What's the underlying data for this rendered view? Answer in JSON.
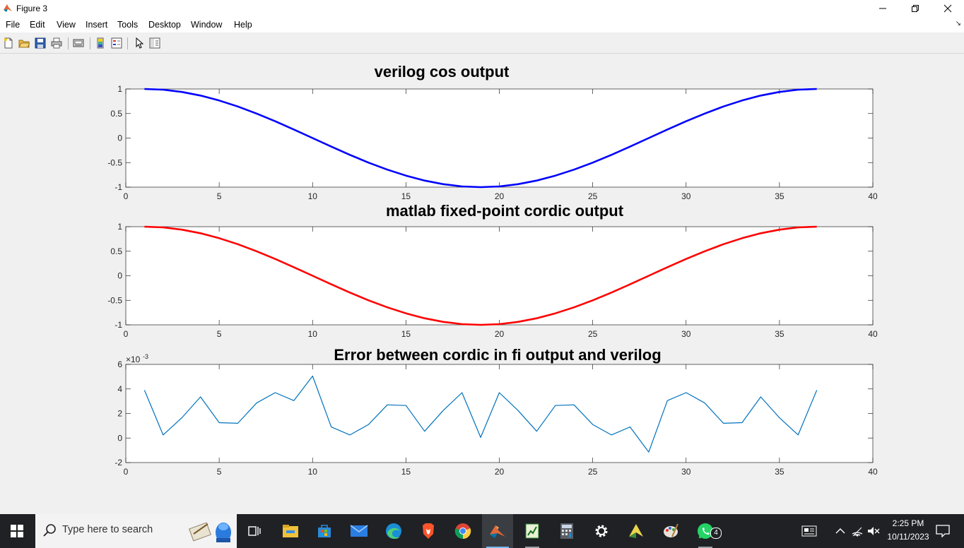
{
  "window": {
    "title": "Figure 3",
    "buttons": [
      "minimize",
      "restore",
      "close"
    ]
  },
  "menubar": {
    "items": [
      "File",
      "Edit",
      "View",
      "Insert",
      "Tools",
      "Desktop",
      "Window",
      "Help"
    ]
  },
  "toolbar": {
    "buttons": [
      "new-figure-icon",
      "open-file-icon",
      "save-icon",
      "print-icon",
      "link-plot-icon",
      "colorbar-icon",
      "legend-icon",
      "edit-plot-icon",
      "property-inspector-icon"
    ]
  },
  "chart_data": [
    {
      "type": "line",
      "title": "verilog cos output",
      "xlim": [
        0,
        40
      ],
      "ylim": [
        -1,
        1
      ],
      "xticks": [
        "0",
        "5",
        "10",
        "15",
        "20",
        "25",
        "30",
        "35",
        "40"
      ],
      "yticks": [
        "1",
        "0.5",
        "0",
        "-0.5",
        "-1"
      ],
      "color": "#0000ff",
      "grid": false,
      "series": [
        {
          "x": [
            1,
            2,
            3,
            4,
            5,
            6,
            7,
            8,
            9,
            10,
            11,
            12,
            13,
            14,
            15,
            16,
            17,
            18,
            19,
            20,
            21,
            22,
            23,
            24,
            25,
            26,
            27,
            28,
            29,
            30,
            31,
            32,
            33,
            34,
            35,
            36,
            37
          ],
          "values": [
            1.0,
            0.985,
            0.94,
            0.866,
            0.766,
            0.643,
            0.5,
            0.342,
            0.174,
            0.0,
            -0.174,
            -0.342,
            -0.5,
            -0.643,
            -0.766,
            -0.866,
            -0.94,
            -0.985,
            -1.0,
            -0.985,
            -0.94,
            -0.866,
            -0.766,
            -0.643,
            -0.5,
            -0.342,
            -0.174,
            0.0,
            0.174,
            0.342,
            0.5,
            0.643,
            0.766,
            0.866,
            0.94,
            0.985,
            1.0
          ]
        }
      ]
    },
    {
      "type": "line",
      "title": "matlab fixed-point cordic output",
      "xlim": [
        0,
        40
      ],
      "ylim": [
        -1,
        1
      ],
      "xticks": [
        "0",
        "5",
        "10",
        "15",
        "20",
        "25",
        "30",
        "35",
        "40"
      ],
      "yticks": [
        "1",
        "0.5",
        "0",
        "-0.5",
        "-1"
      ],
      "color": "#ff0000",
      "grid": false,
      "series": [
        {
          "x": [
            1,
            2,
            3,
            4,
            5,
            6,
            7,
            8,
            9,
            10,
            11,
            12,
            13,
            14,
            15,
            16,
            17,
            18,
            19,
            20,
            21,
            22,
            23,
            24,
            25,
            26,
            27,
            28,
            29,
            30,
            31,
            32,
            33,
            34,
            35,
            36,
            37
          ],
          "values": [
            1.0,
            0.985,
            0.94,
            0.866,
            0.766,
            0.643,
            0.5,
            0.342,
            0.174,
            0.0,
            -0.174,
            -0.342,
            -0.5,
            -0.643,
            -0.766,
            -0.866,
            -0.94,
            -0.985,
            -1.0,
            -0.985,
            -0.94,
            -0.866,
            -0.766,
            -0.643,
            -0.5,
            -0.342,
            -0.174,
            0.0,
            0.174,
            0.342,
            0.5,
            0.643,
            0.766,
            0.866,
            0.94,
            0.985,
            1.0
          ]
        }
      ]
    },
    {
      "type": "line",
      "title": "Error between cordic in fi output and verilog",
      "xlim": [
        0,
        40
      ],
      "ylim": [
        -2,
        6
      ],
      "exponent_label": "×10",
      "exponent_power": "-3",
      "xticks": [
        "0",
        "5",
        "10",
        "15",
        "20",
        "25",
        "30",
        "35",
        "40"
      ],
      "yticks": [
        "6",
        "4",
        "2",
        "0",
        "-2"
      ],
      "color": "#0072bd",
      "grid": false,
      "series": [
        {
          "x": [
            1,
            2,
            3,
            4,
            5,
            6,
            7,
            8,
            9,
            10,
            11,
            12,
            13,
            14,
            15,
            16,
            17,
            18,
            19,
            20,
            21,
            22,
            23,
            24,
            25,
            26,
            27,
            28,
            29,
            30,
            31,
            32,
            33,
            34,
            35,
            36,
            37
          ],
          "values": [
            3.9,
            0.25,
            1.65,
            3.35,
            1.25,
            1.2,
            2.85,
            3.7,
            3.05,
            5.05,
            0.9,
            0.25,
            1.1,
            2.7,
            2.65,
            0.55,
            2.25,
            3.7,
            0.05,
            3.7,
            2.25,
            0.55,
            2.65,
            2.7,
            1.1,
            0.25,
            0.9,
            -1.15,
            3.05,
            3.7,
            2.85,
            1.2,
            1.25,
            3.35,
            1.65,
            0.25,
            3.9
          ]
        }
      ]
    }
  ],
  "taskbar": {
    "search_placeholder": "Type here to search",
    "apps": [
      "task-view-icon",
      "file-explorer-icon",
      "microsoft-store-icon",
      "mail-icon",
      "edge-icon",
      "brave-icon",
      "chrome-icon",
      "matlab-icon",
      "notepad-chart-icon",
      "calculator-icon",
      "settings-icon",
      "vivado-icon",
      "paint-icon",
      "whatsapp-icon"
    ],
    "whatsapp_badge": "4",
    "clock_time": "2:25 PM",
    "clock_date": "10/11/2023"
  }
}
